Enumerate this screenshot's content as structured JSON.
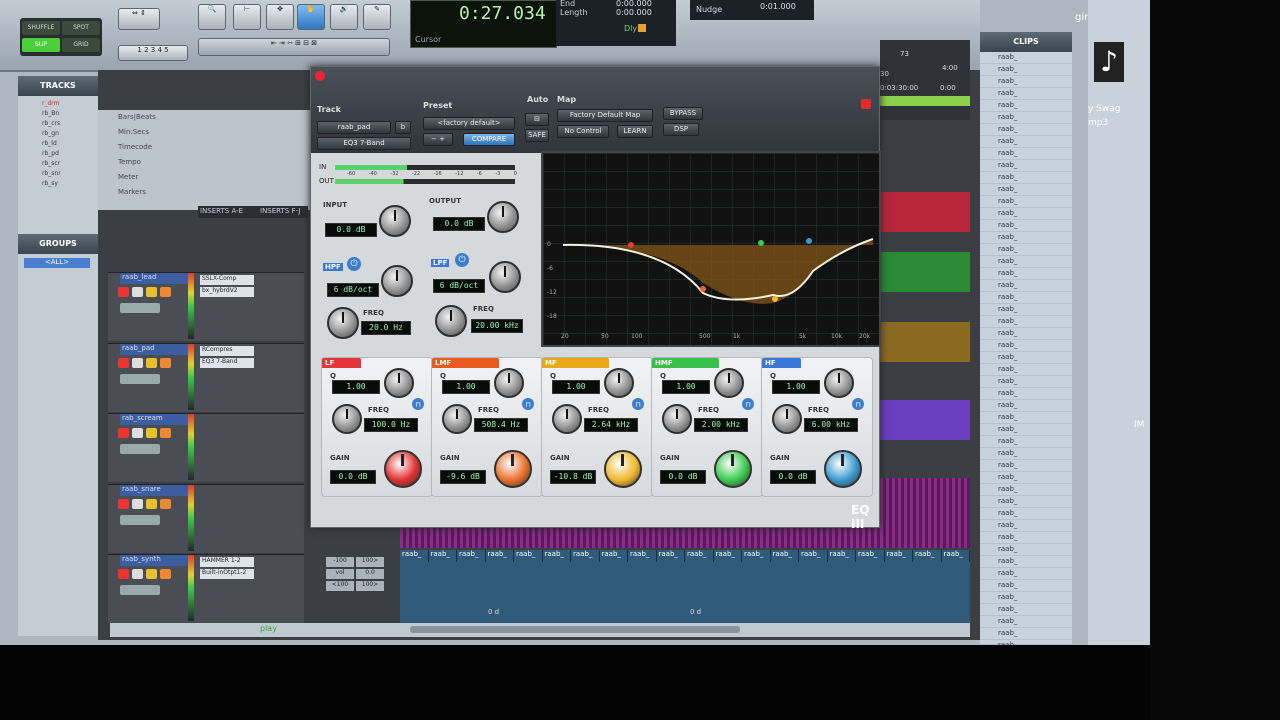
{
  "toolbar": {
    "modes": [
      "SHUFFLE",
      "SPOT",
      "SLIP",
      "GRID"
    ],
    "counter_main": "0:27.034",
    "counter_labels": [
      "End",
      "Length"
    ],
    "counter_values": [
      "0:00.000",
      "0:00.000"
    ],
    "cursor_label": "Cursor",
    "nudge_label": "Nudge",
    "nudge_value": "0:01.000",
    "dly_label": "Dly",
    "right_text": "gins"
  },
  "tracks_panel": {
    "title": "TRACKS",
    "items": [
      "r_drm",
      "rb_Bn",
      "rb_crs",
      "rb_gn",
      "rb_ld",
      "rb_pd",
      "rb_scr",
      "rb_snr",
      "rb_sy"
    ]
  },
  "groups_panel": {
    "title": "GROUPS",
    "items": [
      "<ALL>"
    ]
  },
  "ruler_rows": [
    "Bars|Beats",
    "Min:Secs",
    "Timecode",
    "Tempo",
    "Meter",
    "Markers"
  ],
  "insert_headers": [
    "INSERTS A-E",
    "INSERTS F-J"
  ],
  "mix_strips": [
    {
      "name": "raab_lead",
      "inserts": [
        "SSLX-Comp",
        "bx_hybrdV2"
      ]
    },
    {
      "name": "raab_pad",
      "inserts": [
        "RCompres",
        "EQ3 7-Band"
      ]
    },
    {
      "name": "rab_scream",
      "inserts": []
    },
    {
      "name": "raab_snare",
      "inserts": []
    },
    {
      "name": "raab_synth",
      "inserts": [
        "HAMMER 1-2",
        "Built-inOtpt1-2"
      ]
    }
  ],
  "io_values": [
    "-100",
    "100>",
    "vol",
    "0.0",
    "<100",
    "100>"
  ],
  "timeline_clip_label": "raab_",
  "clip_offset_label": "0 d",
  "status_text": "play",
  "clips_panel": {
    "title": "CLIPS",
    "row_label": "raab_"
  },
  "desktop_file": {
    "label_lines": [
      "y Swag",
      "mp3"
    ]
  },
  "right_edge_text": "IM",
  "ruler_values": [
    "73",
    "4:00",
    "30",
    "0:03:30:00",
    "0:00"
  ],
  "plugin": {
    "header_labels": [
      "Track",
      "Preset",
      "Auto",
      "Map"
    ],
    "track_name": "raab_pad",
    "track_suffix": "b",
    "insert_name": "EQ3 7-Band",
    "preset_name": "<factory default>",
    "compare_label": "COMPARE",
    "safe_label": "SAFE",
    "map_name": "Factory Default Map",
    "no_control_label": "No Control",
    "learn_label": "LEARN",
    "bypass_label": "BYPASS",
    "dsp_label": "DSP",
    "meter_labels": [
      "IN",
      "OUT"
    ],
    "meter_scale": [
      "-60",
      "-40",
      "-32",
      "-22",
      "-16",
      "-12",
      "-6",
      "-3",
      "0"
    ],
    "input_label": "INPUT",
    "input_value": "0.0 dB",
    "output_label": "OUTPUT",
    "output_value": "0.0 dB",
    "hpf": {
      "label": "HPF",
      "slope": "6 dB/oct",
      "freq_label": "FREQ",
      "freq": "20.0 Hz"
    },
    "lpf": {
      "label": "LPF",
      "slope": "6 dB/oct",
      "freq_label": "FREQ",
      "freq": "20.00 kHz"
    },
    "graph_db_labels": [
      "0",
      "-6",
      "-12",
      "-18"
    ],
    "graph_freq_labels": [
      "20",
      "50",
      "100",
      "500",
      "1k",
      "5k",
      "10k",
      "20k"
    ],
    "bands": [
      {
        "tag": "LF",
        "tag_color": "#e6343b",
        "q": "1.00",
        "freq": "100.0 Hz",
        "gain": "0.0 dB",
        "knob_color": "#e23030"
      },
      {
        "tag": "LMF",
        "tag_color": "#e85a20",
        "q": "1.00",
        "freq": "508.4 Hz",
        "gain": "-9.6 dB",
        "knob_color": "#e8702c"
      },
      {
        "tag": "MF",
        "tag_color": "#e8a818",
        "q": "1.00",
        "freq": "2.64 kHz",
        "gain": "-10.8 dB",
        "knob_color": "#f0b82c"
      },
      {
        "tag": "HMF",
        "tag_color": "#38c04a",
        "q": "1.00",
        "freq": "2.00 kHz",
        "gain": "0.0 dB",
        "knob_color": "#3bcb50"
      },
      {
        "tag": "HF",
        "tag_color": "#3a78d8",
        "q": "1.00",
        "freq": "6.00 kHz",
        "gain": "0.0 dB",
        "knob_color": "#3a9ad0"
      }
    ],
    "q_label": "Q",
    "freq_label": "FREQ",
    "gain_label": "GAIN",
    "logo": "EQ III"
  }
}
